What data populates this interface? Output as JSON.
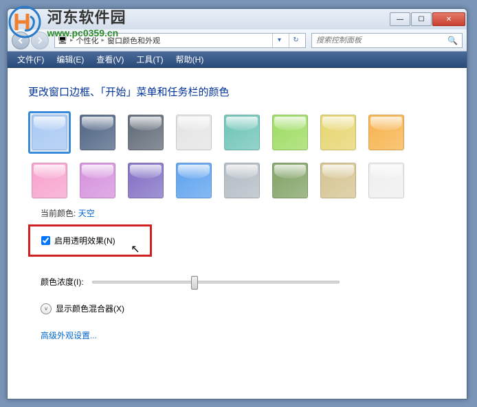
{
  "watermark": {
    "text1": "河东软件园",
    "text2": "www.pc0359.cn"
  },
  "breadcrumb": {
    "seg1": "个性化",
    "seg2": "窗口颜色和外观"
  },
  "search": {
    "placeholder": "搜索控制面板"
  },
  "menu": {
    "file": "文件(F)",
    "edit": "编辑(E)",
    "view": "查看(V)",
    "tools": "工具(T)",
    "help": "帮助(H)"
  },
  "heading": "更改窗口边框、「开始」菜单和任务栏的颜色",
  "colors": [
    "#aeccf4",
    "#5b6f8c",
    "#6a7480",
    "#e6e6e6",
    "#78c8bc",
    "#a4de6c",
    "#e8d878",
    "#f8b858",
    "#f8a8d0",
    "#d898e0",
    "#8a78c8",
    "#68a8f0",
    "#b8c0c8",
    "#8aa870",
    "#d8c898",
    "#f0f0f0"
  ],
  "current_label": "当前颜色:",
  "current_value": "天空",
  "transparency_label": "启用透明效果(N)",
  "transparency_checked": true,
  "intensity_label": "颜色浓度(I):",
  "mixer_label": "显示颜色混合器(X)",
  "advanced_link": "高级外观设置..."
}
